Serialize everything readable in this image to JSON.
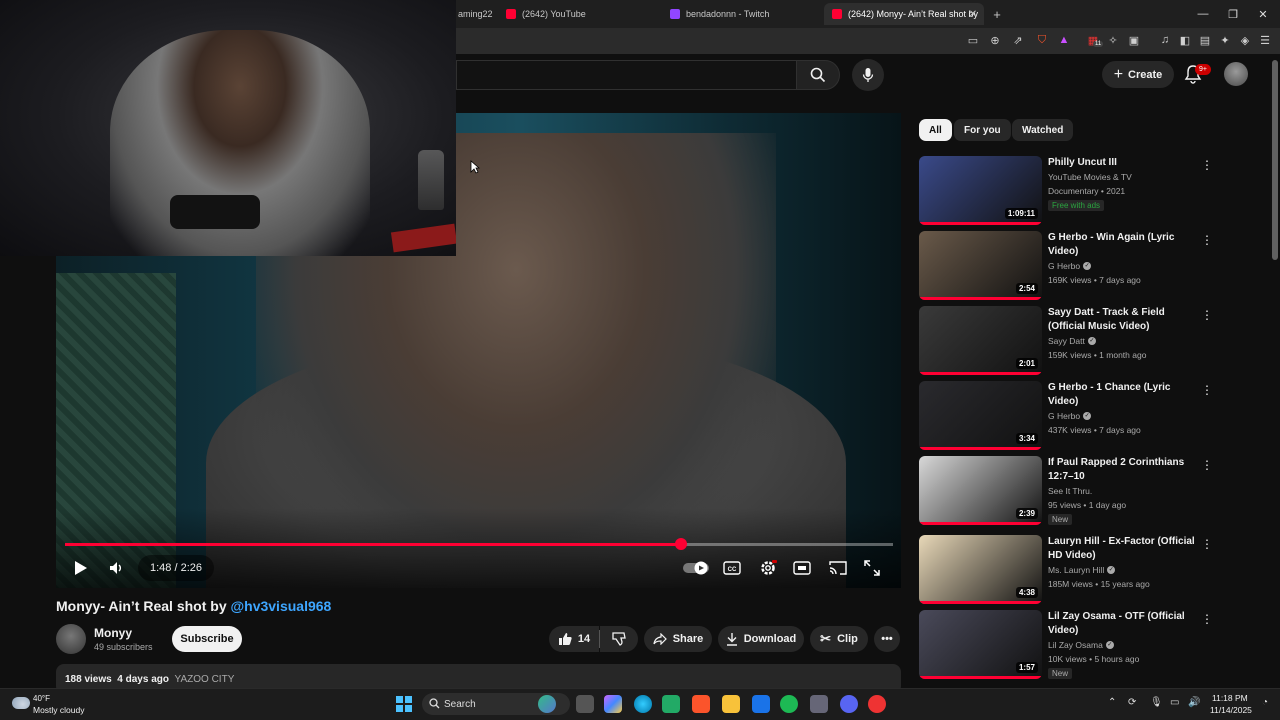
{
  "browser": {
    "tabs": [
      {
        "label": "aming22",
        "favicon_color": "#1f1f1f"
      },
      {
        "label": "(2642) YouTube",
        "favicon_color": "#ff0033"
      },
      {
        "label": "bendadonnn - Twitch",
        "favicon_color": "#9146ff"
      },
      {
        "label": "(2642) Monyy- Ain’t Real shot by",
        "favicon_color": "#ff0033"
      }
    ],
    "new_tab": "+",
    "close_tab": "✕",
    "window_controls": [
      "—",
      "❐",
      "✕"
    ],
    "extension_badge": "11"
  },
  "header": {
    "create_label": "Create",
    "notification_badge": "9+"
  },
  "player": {
    "time": "1:48 / 2:26",
    "progress": 0.744
  },
  "video": {
    "title": "Monyy- Ain’t Real shot by",
    "title_handle": "@hv3visual968",
    "channel_name": "Monyy",
    "subscribers": "49 subscribers",
    "subscribe_label": "Subscribe",
    "likes": "14",
    "share_label": "Share",
    "download_label": "Download",
    "clip_label": "Clip",
    "views": "188 views",
    "age": "4 days ago",
    "location": "YAZOO CITY"
  },
  "chips": [
    "All",
    "For you",
    "Watched"
  ],
  "recommendations": [
    {
      "title": "Philly Uncut III",
      "channel": "YouTube Movies & TV",
      "meta": "Documentary • 2021",
      "badge": "Free with ads",
      "duration": "1:09:11",
      "verified": false,
      "thumb": "#3a4a8a"
    },
    {
      "title": "G Herbo - Win Again (Lyric Video)",
      "channel": "G Herbo",
      "meta": "169K views • 7 days ago",
      "badge": "",
      "duration": "2:54",
      "verified": true,
      "thumb": "#6a5a4a"
    },
    {
      "title": "Sayy Datt - Track & Field (Official Music Video)",
      "channel": "Sayy Datt",
      "meta": "159K views • 1 month ago",
      "badge": "",
      "duration": "2:01",
      "verified": true,
      "thumb": "#3a3a3a"
    },
    {
      "title": "G Herbo - 1 Chance (Lyric Video)",
      "channel": "G Herbo",
      "meta": "437K views • 7 days ago",
      "badge": "",
      "duration": "3:34",
      "verified": true,
      "thumb": "#2a2a2e"
    },
    {
      "title": "If Paul Rapped 2 Corinthians 12:7–10",
      "channel": "See It Thru.",
      "meta": "95 views • 1 day ago",
      "badge": "New",
      "duration": "2:39",
      "verified": false,
      "thumb": "#d8d8d8"
    },
    {
      "title": "Lauryn Hill - Ex-Factor (Official HD Video)",
      "channel": "Ms. Lauryn Hill",
      "meta": "185M views • 15 years ago",
      "badge": "",
      "duration": "4:38",
      "verified": true,
      "thumb": "#e8d8b8"
    },
    {
      "title": "Lil Zay Osama - OTF (Official Video)",
      "channel": "Lil Zay Osama",
      "meta": "10K views • 5 hours ago",
      "badge": "New",
      "duration": "1:57",
      "verified": true,
      "thumb": "#4a4a5a"
    }
  ],
  "taskbar": {
    "temperature": "40°F",
    "weather": "Mostly cloudy",
    "search_label": "Search",
    "time": "11:18 PM",
    "date": "11/14/2025"
  }
}
